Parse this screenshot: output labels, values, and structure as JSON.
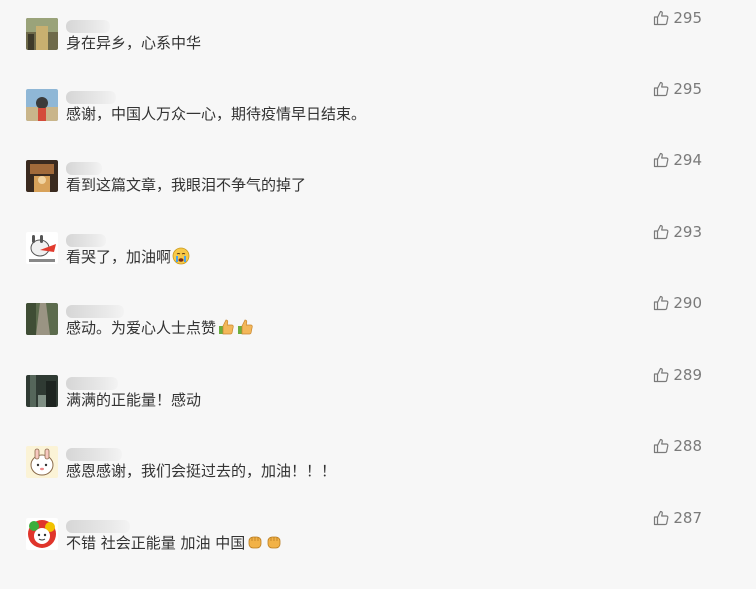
{
  "comments": [
    {
      "text": "身在异乡，心系中华",
      "likes": "295",
      "emoji": [],
      "avatar": "street-photo"
    },
    {
      "text": "感谢，中国人万众一心，期待疫情早日结束。",
      "likes": "295",
      "emoji": [],
      "avatar": "person-photo"
    },
    {
      "text": "看到这篇文章，我眼泪不争气的掉了",
      "likes": "294",
      "emoji": [],
      "avatar": "dark-room-photo"
    },
    {
      "text": "看哭了，加油啊",
      "likes": "293",
      "emoji": [
        "crying-face-emoji"
      ],
      "avatar": "cartoon-rabbit"
    },
    {
      "text": "感动。为爱心人士点赞",
      "likes": "290",
      "emoji": [
        "thumbs-up-emoji",
        "thumbs-up-emoji"
      ],
      "avatar": "path-photo"
    },
    {
      "text": "满满的正能量！感动",
      "likes": "289",
      "emoji": [],
      "avatar": "street-night-photo"
    },
    {
      "text": "感恩感谢，我们会挺过去的，加油！！！",
      "likes": "288",
      "emoji": [],
      "avatar": "cartoon-girl"
    },
    {
      "text": "不错 社会正能量 加油 中国",
      "likes": "287",
      "emoji": [
        "fist-emoji",
        "fist-emoji"
      ],
      "avatar": "cartoon-flower"
    }
  ],
  "icons": {
    "like": "thumbs-up-outline-icon"
  },
  "colors": {
    "text": "#333333",
    "like": "#7a7a7a",
    "background": "#f7f7f7"
  }
}
